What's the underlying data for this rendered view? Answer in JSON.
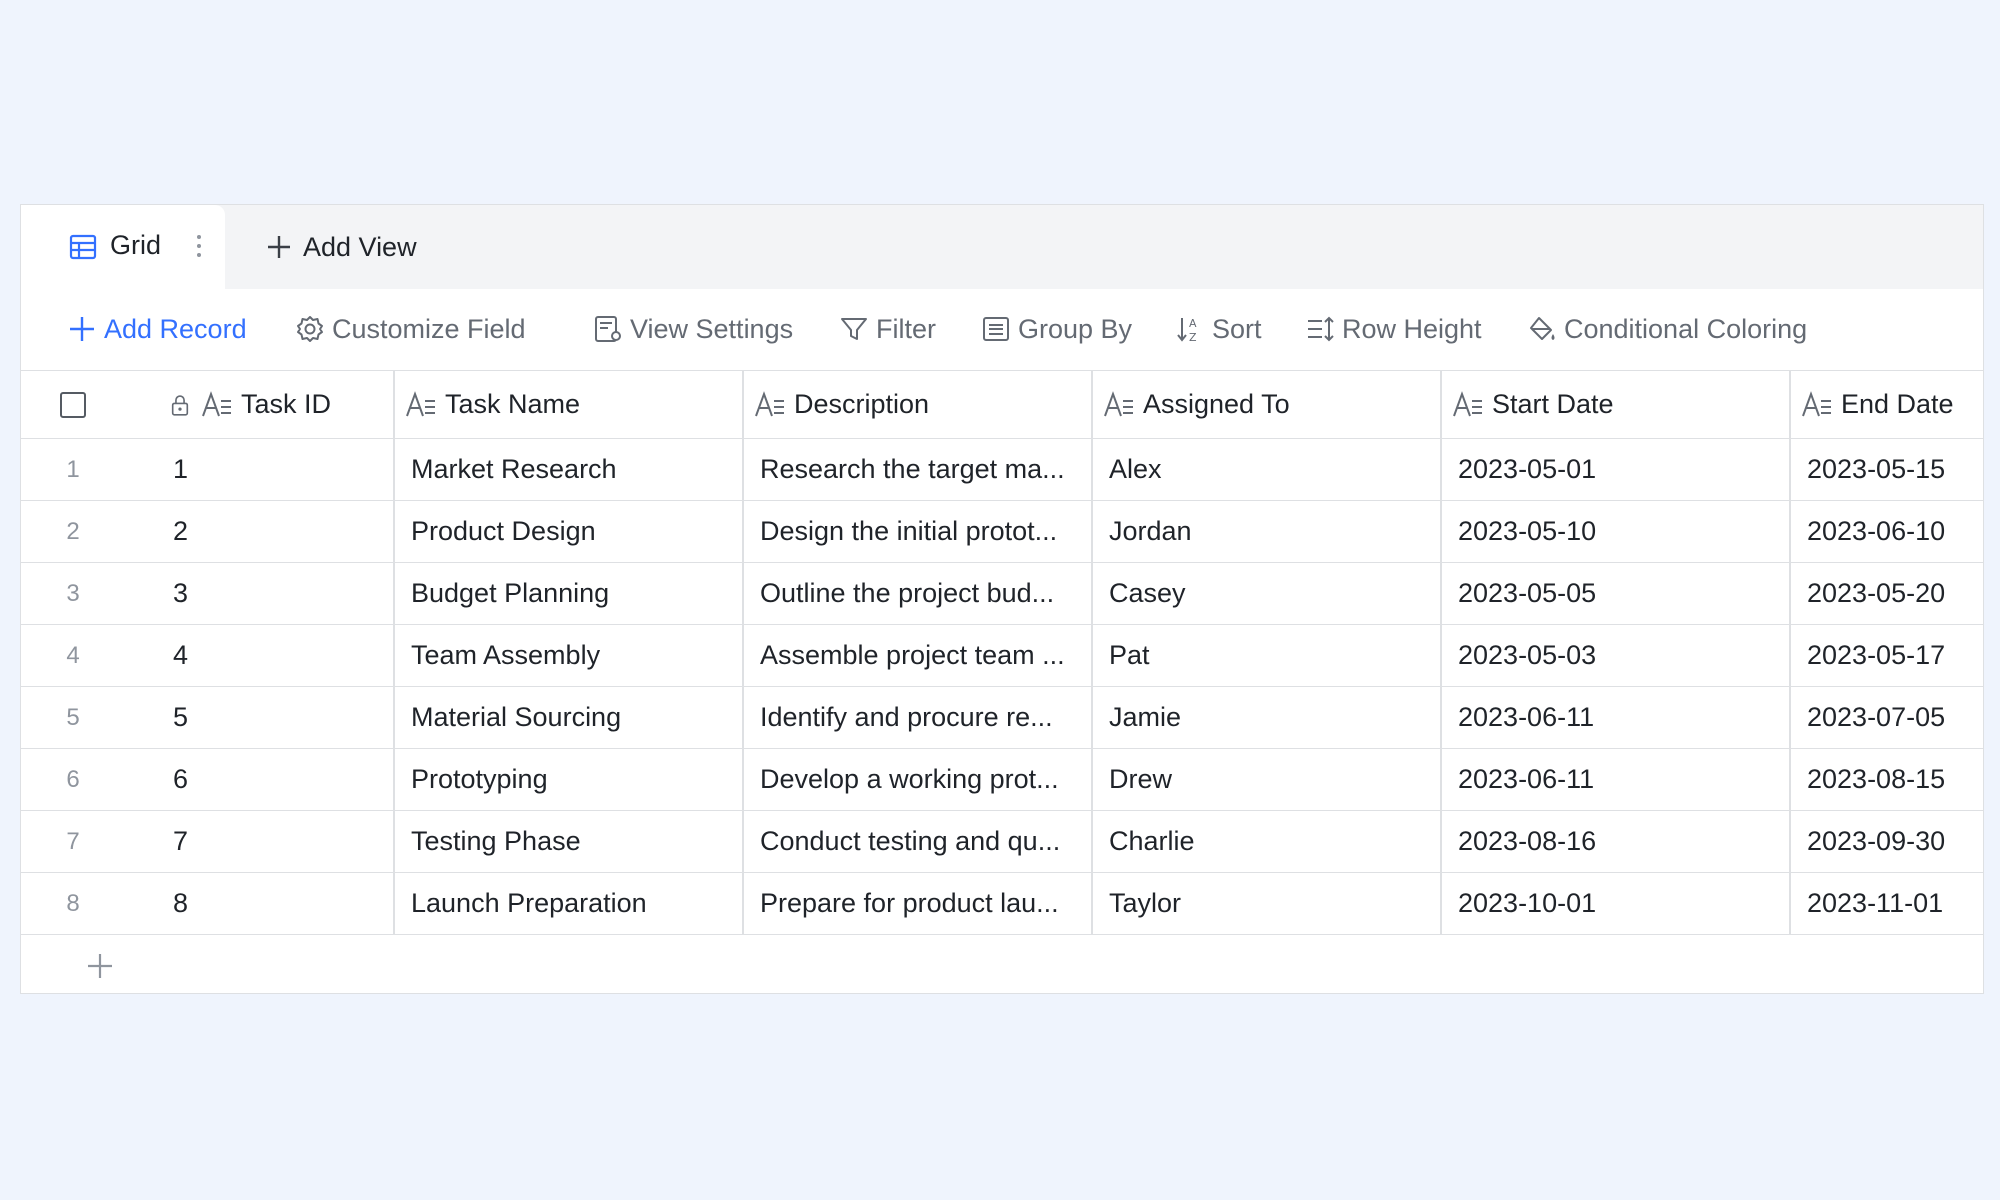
{
  "tabs": {
    "grid_label": "Grid",
    "add_view_label": "Add View"
  },
  "toolbar": {
    "add_record": "Add Record",
    "customize_field": "Customize Field",
    "view_settings": "View Settings",
    "filter": "Filter",
    "group_by": "Group By",
    "sort": "Sort",
    "row_height": "Row Height",
    "conditional_coloring": "Conditional Coloring"
  },
  "columns": [
    "Task ID",
    "Task Name",
    "Description",
    "Assigned To",
    "Start Date",
    "End Date"
  ],
  "rows": [
    {
      "num": "1",
      "task_id": "1",
      "task_name": "Market Research",
      "description": "Research the target ma...",
      "assigned_to": "Alex",
      "start_date": "2023-05-01",
      "end_date": "2023-05-15"
    },
    {
      "num": "2",
      "task_id": "2",
      "task_name": "Product Design",
      "description": "Design the initial protot...",
      "assigned_to": "Jordan",
      "start_date": "2023-05-10",
      "end_date": "2023-06-10"
    },
    {
      "num": "3",
      "task_id": "3",
      "task_name": "Budget Planning",
      "description": "Outline the project bud...",
      "assigned_to": "Casey",
      "start_date": "2023-05-05",
      "end_date": "2023-05-20"
    },
    {
      "num": "4",
      "task_id": "4",
      "task_name": "Team Assembly",
      "description": "Assemble project team ...",
      "assigned_to": "Pat",
      "start_date": "2023-05-03",
      "end_date": "2023-05-17"
    },
    {
      "num": "5",
      "task_id": "5",
      "task_name": "Material Sourcing",
      "description": "Identify and procure re...",
      "assigned_to": "Jamie",
      "start_date": "2023-06-11",
      "end_date": "2023-07-05"
    },
    {
      "num": "6",
      "task_id": "6",
      "task_name": "Prototyping",
      "description": "Develop a working prot...",
      "assigned_to": "Drew",
      "start_date": "2023-06-11",
      "end_date": "2023-08-15"
    },
    {
      "num": "7",
      "task_id": "7",
      "task_name": "Testing Phase",
      "description": "Conduct testing and qu...",
      "assigned_to": "Charlie",
      "start_date": "2023-08-16",
      "end_date": "2023-09-30"
    },
    {
      "num": "8",
      "task_id": "8",
      "task_name": "Launch Preparation",
      "description": "Prepare for product lau...",
      "assigned_to": "Taylor",
      "start_date": "2023-10-01",
      "end_date": "2023-11-01"
    }
  ],
  "colors": {
    "accent": "#3370ff",
    "background": "#eff4fd",
    "border": "#dee0e3",
    "muted_text": "#646a73"
  }
}
